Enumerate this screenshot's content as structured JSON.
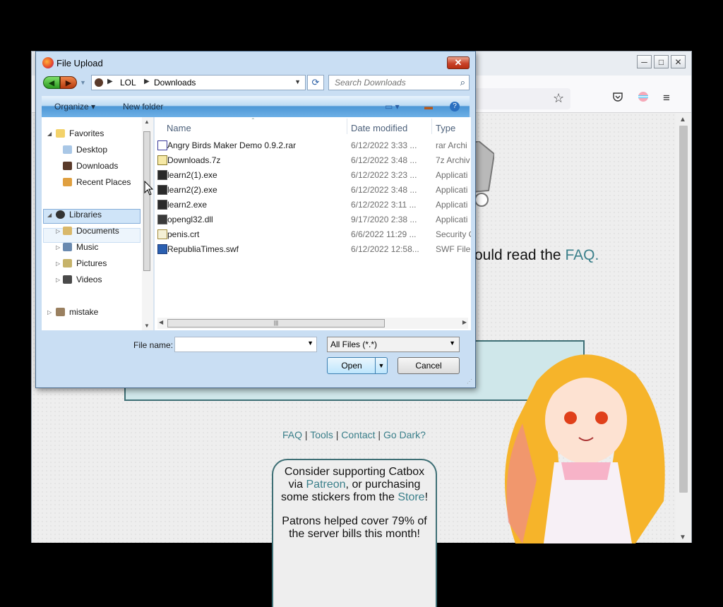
{
  "browser": {
    "window_controls": [
      "─",
      "□",
      "✕"
    ],
    "page": {
      "faq_line_prefix": "ould read the ",
      "faq_link": "FAQ.",
      "links": [
        "FAQ",
        "Tools",
        "Contact",
        "Go Dark?"
      ],
      "link_sep": " | ",
      "support": {
        "line1": "Consider supporting Catbox",
        "line2_pre": "via ",
        "patreon": "Patreon",
        "line2_post": ", or purchasing",
        "line3_pre": "some stickers from the ",
        "store": "Store",
        "line3_post": "!",
        "line4": "Patrons helped cover 79% of",
        "line5": "the server bills this month!"
      }
    },
    "toolbar_icons": [
      "star-icon",
      "pocket-icon",
      "account-icon",
      "menu-icon"
    ]
  },
  "dialog": {
    "title": "File Upload",
    "close": "✕",
    "breadcrumb": [
      "LOL",
      "Downloads"
    ],
    "search_placeholder": "Search Downloads",
    "commands": {
      "organize": "Organize",
      "new_folder": "New folder"
    },
    "tree": {
      "favorites": "Favorites",
      "favorites_items": [
        "Desktop",
        "Downloads",
        "Recent Places"
      ],
      "selected": "Downloads",
      "libraries": "Libraries",
      "libraries_items": [
        "Documents",
        "Music",
        "Pictures",
        "Videos"
      ],
      "other": "mistake"
    },
    "columns": {
      "name": "Name",
      "date": "Date modified",
      "type": "Type"
    },
    "files": [
      {
        "name": "Angry Birds Maker Demo 0.9.2.rar",
        "date": "6/12/2022 3:33 ...",
        "type": "rar Archi",
        "icon": "rar-icon"
      },
      {
        "name": "Downloads.7z",
        "date": "6/12/2022 3:48 ...",
        "type": "7z Archiv",
        "icon": "archive-icon"
      },
      {
        "name": "learn2(1).exe",
        "date": "6/12/2022 3:23 ...",
        "type": "Applicati",
        "icon": "exe-icon"
      },
      {
        "name": "learn2(2).exe",
        "date": "6/12/2022 3:48 ...",
        "type": "Applicati",
        "icon": "exe-icon"
      },
      {
        "name": "learn2.exe",
        "date": "6/12/2022 3:11 ...",
        "type": "Applicati",
        "icon": "exe-icon"
      },
      {
        "name": "opengl32.dll",
        "date": "9/17/2020 2:38 ...",
        "type": "Applicati",
        "icon": "dll-icon"
      },
      {
        "name": "penis.crt",
        "date": "6/6/2022 11:29 ...",
        "type": "Security C",
        "icon": "certificate-icon"
      },
      {
        "name": "RepubliaTimes.swf",
        "date": "6/12/2022 12:58...",
        "type": "SWF File",
        "icon": "swf-icon"
      }
    ],
    "file_name_label": "File name:",
    "file_name_value": "",
    "file_type": "All Files (*.*)",
    "open": "Open",
    "cancel": "Cancel"
  }
}
